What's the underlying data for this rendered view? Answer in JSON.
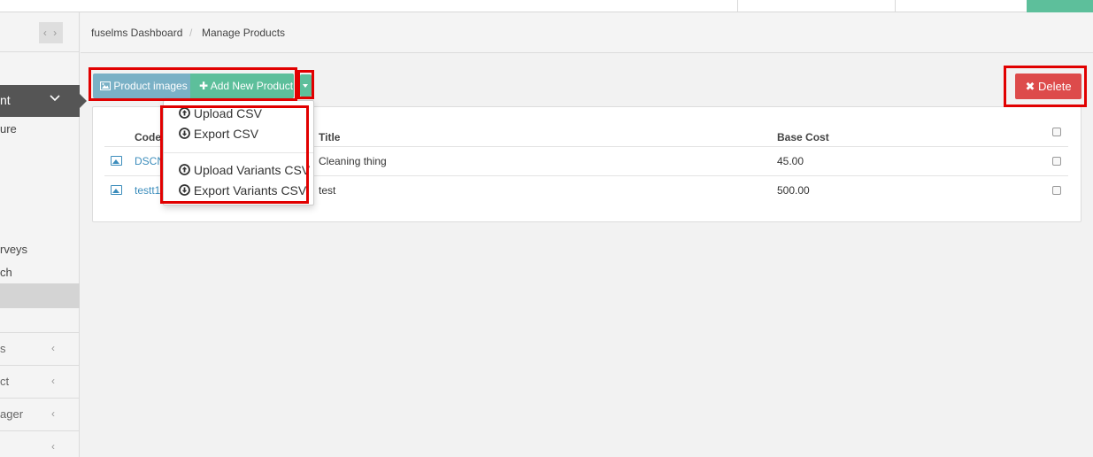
{
  "colors": {
    "accent_teal": "#5dbf9b",
    "images_button": "#7ab1c6",
    "delete_button": "#dd4b4b",
    "link": "#3c8dbc",
    "sidebar_active": "#555555",
    "highlight_box": "#e10000"
  },
  "sidebar": {
    "active_item": "nt",
    "sub_items": [
      "ure",
      "rveys",
      "ch"
    ],
    "menu_rows": [
      "s",
      "ct",
      "ager",
      ""
    ]
  },
  "breadcrumb": {
    "home": "fuselms Dashboard",
    "separator": "/",
    "current": "Manage Products"
  },
  "toolbar": {
    "images_label": "Product images",
    "add_label": "Add New Product",
    "delete_label": "Delete"
  },
  "table": {
    "headers": [
      "Code",
      "Title",
      "Base Cost"
    ],
    "rows": [
      {
        "code": "DSCN",
        "title": "Cleaning thing",
        "base_cost": "45.00"
      },
      {
        "code": "testt1",
        "title": "test",
        "base_cost": "500.00"
      }
    ]
  },
  "dropdown": {
    "items": [
      "Upload CSV",
      "Export CSV",
      "Upload Variants CSV",
      "Export Variants CSV"
    ]
  }
}
